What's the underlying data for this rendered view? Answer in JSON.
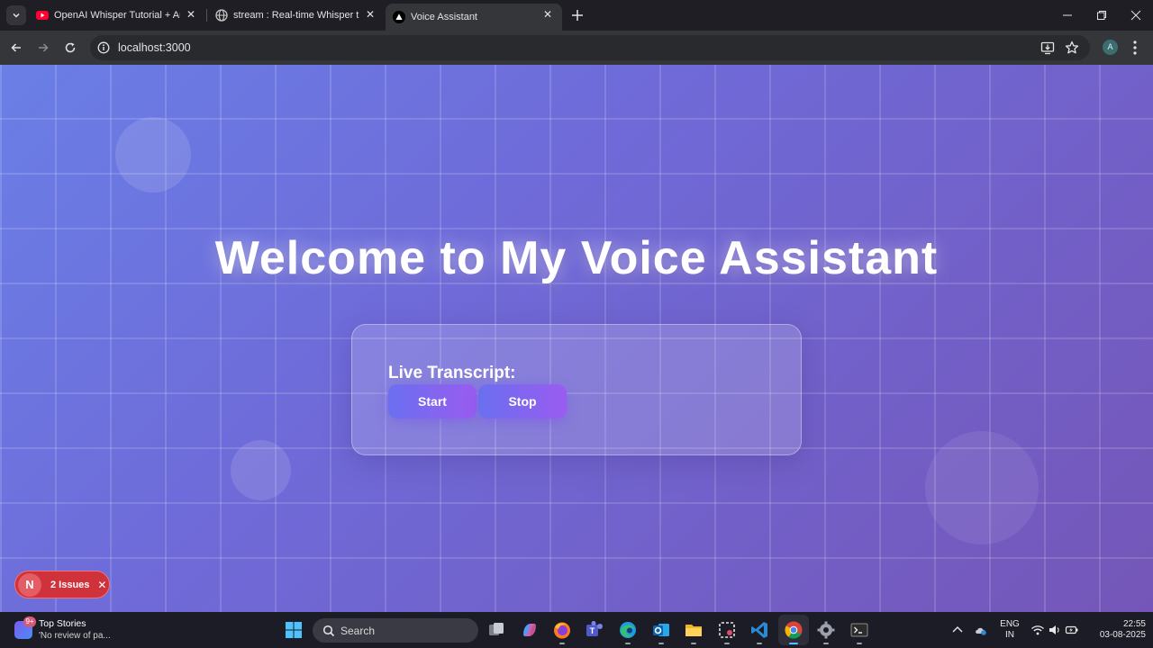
{
  "browser": {
    "tabs": [
      {
        "title": "OpenAI Whisper Tutorial + Aud",
        "favicon": "youtube-icon"
      },
      {
        "title": "stream : Real-time Whisper tran",
        "favicon": "globe-icon"
      },
      {
        "title": "Voice Assistant",
        "favicon": "vercel-triangle-icon",
        "active": true
      }
    ],
    "url": "localhost:3000"
  },
  "page": {
    "headline": "Welcome to My Voice Assistant",
    "transcript_label": "Live Transcript:",
    "start_label": "Start",
    "stop_label": "Stop",
    "issues": {
      "badge": "N",
      "label": "2 Issues"
    }
  },
  "taskbar": {
    "news_title": "Top Stories",
    "news_subtitle": "'No review of pa...",
    "news_badge": "9+",
    "search_label": "Search",
    "language": "ENG",
    "region": "IN",
    "time": "22:55",
    "date": "03-08-2025"
  },
  "colors": {
    "accent_gradient_start": "#6a6ff0",
    "accent_gradient_end": "#9a5cf0",
    "issues_red": "#d0323c"
  }
}
